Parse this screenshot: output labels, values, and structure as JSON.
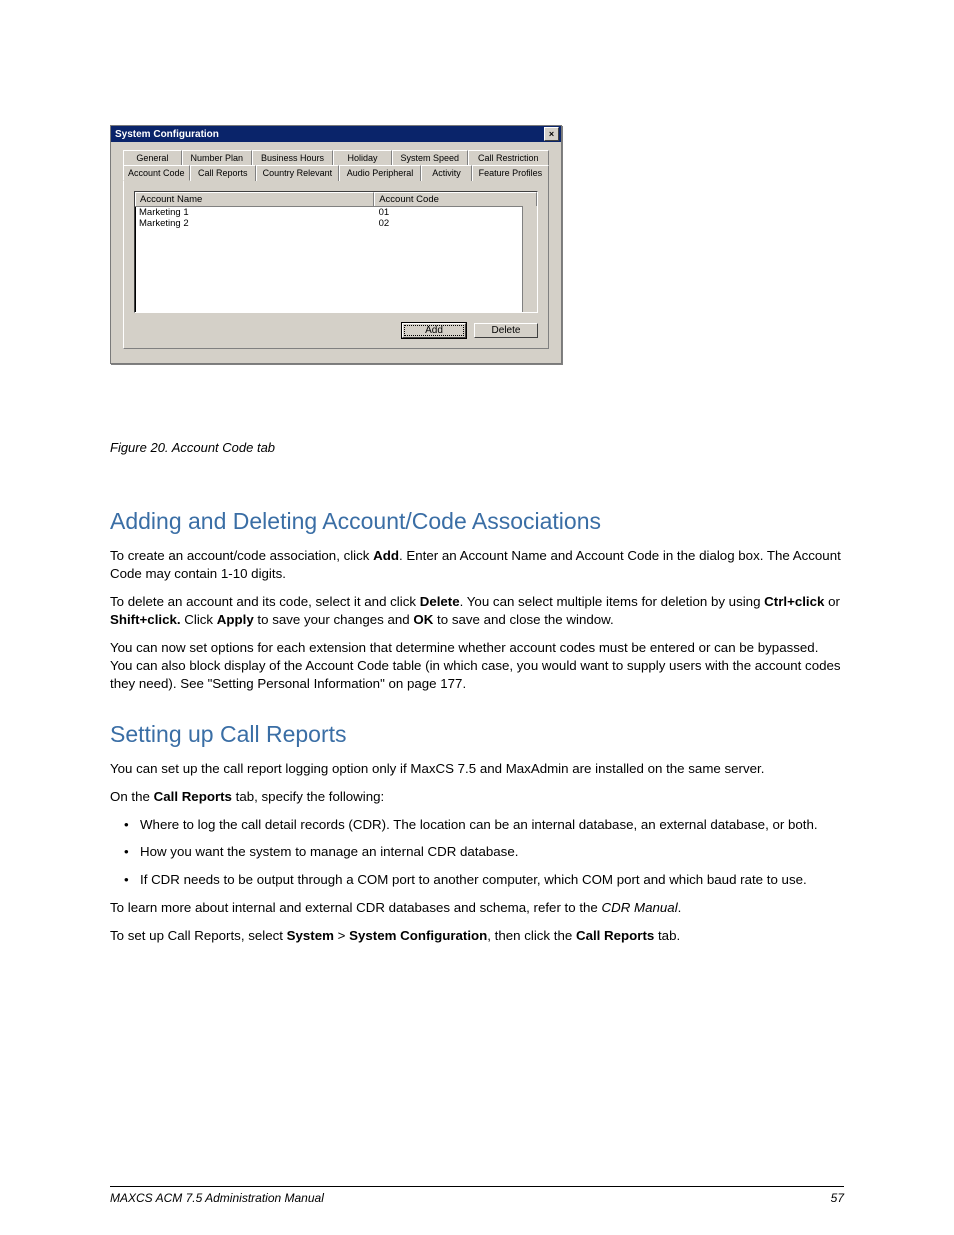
{
  "dialog": {
    "title": "System Configuration",
    "close_label": "×",
    "tabs_back": [
      "General",
      "Number Plan",
      "Business Hours",
      "Holiday",
      "System Speed",
      "Call Restriction"
    ],
    "tabs_front": [
      "Account Code",
      "Call Reports",
      "Country Relevant",
      "Audio Peripheral",
      "Activity",
      "Feature Profiles"
    ],
    "list_headers": {
      "name": "Account Name",
      "code": "Account Code"
    },
    "rows": [
      {
        "name": "Marketing 1",
        "code": "01"
      },
      {
        "name": "Marketing 2",
        "code": "02"
      }
    ],
    "add_label": "Add",
    "delete_label": "Delete"
  },
  "figure": {
    "num": "Figure 20.",
    "title": "Account Code tab"
  },
  "body": {
    "sec1_heading": "Adding and Deleting Account/Code Associations",
    "p1_a": "To create an account/code association, click ",
    "p1_b": "Add",
    "p1_c": ". Enter an Account Name and Account Code in the dialog box. The Account Code may contain 1-10 digits.",
    "p2_a": "To delete an account and its code, select it and click ",
    "p2_b": "Delete",
    "p2_c": ". You can select multiple items for deletion by using ",
    "p2_d": "Ctrl+click",
    "p2_e": " or ",
    "p2_f": "Shift+click.",
    "p2_g": " Click ",
    "p2_h": "Apply",
    "p2_i": " to save your changes and ",
    "p2_j": "OK",
    "p2_k": " to save and close the window.",
    "p3": "You can now set options for each extension that determine whether account codes must be entered or can be bypassed. You can also block display of the Account Code table (in which case, you would want to supply users with the account codes they need). See \"Setting Personal Information\" on page 177.",
    "sec2_heading": "Setting up Call Reports",
    "p4": "You can set up the call report logging option only if MaxCS 7.5 and MaxAdmin are installed on the same server.",
    "p5_a": "On the ",
    "p5_b": "Call Reports",
    "p5_c": " tab, specify the following:",
    "b1": "Where to log the call detail records (CDR). The location can be an internal database, an external database, or both.",
    "b2": "How you want the system to manage an internal CDR database.",
    "b3": "If CDR needs to be output through a COM port to another computer, which COM port and which baud rate to use.",
    "p6_a": "To learn more about internal and external CDR databases and schema, refer to the ",
    "p6_b": "CDR Manual",
    "p6_c": ".",
    "p7_a": "To set up Call Reports, select ",
    "p7_b": "System",
    "p7_c": " > ",
    "p7_d": "System Configuration",
    "p7_e": ", then click the ",
    "p7_f": "Call Reports",
    "p7_g": " tab."
  },
  "footer": {
    "left": "MAXCS ACM 7.5 Administration Manual",
    "right": "57"
  }
}
